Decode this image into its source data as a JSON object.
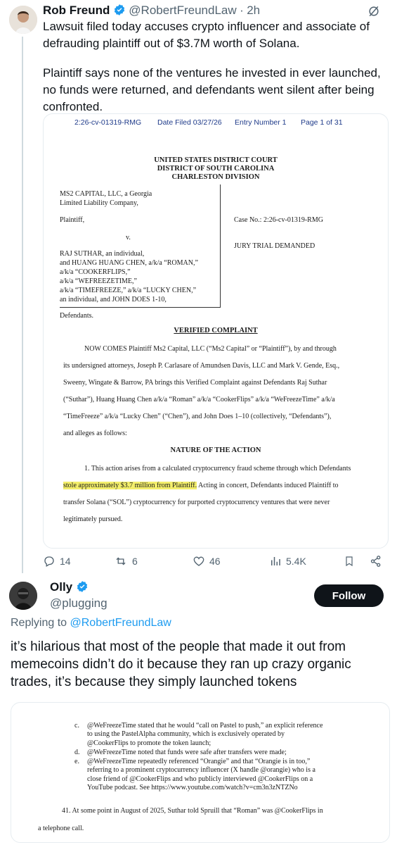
{
  "tweet1": {
    "author": {
      "name": "Rob Freund",
      "handle": "@RobertFreundLaw",
      "time": "2h",
      "verified": true
    },
    "text_p1": "Lawsuit filed today accuses crypto influencer and associate of defrauding plaintiff out of $3.7M worth of Solana.",
    "text_p2": "Plaintiff says none of the ventures he invested in ever launched, no funds were returned, and defendants went silent after being confronted.",
    "document": {
      "case_header": "2:26-cv-01319-RMG",
      "date_filed": "Date Filed 03/27/26",
      "entry_number": "Entry Number 1",
      "page": "Page 1 of 31",
      "court_lines": [
        "UNITED STATES DISTRICT COURT",
        "DISTRICT OF SOUTH CAROLINA",
        "CHARLESTON DIVISION"
      ],
      "plaintiff_lines": [
        "MS2 CAPITAL, LLC, a Georgia",
        "Limited Liability Company,"
      ],
      "plaintiff_label": "Plaintiff,",
      "versus": "v.",
      "case_no": "Case No.: 2:26-cv-01319-RMG",
      "jury": "JURY TRIAL DEMANDED",
      "defendant_lines": [
        "RAJ SUTHAR, an individual,",
        "and HUANG HUANG CHEN, a/k/a “ROMAN,”",
        "a/k/a “COOKERFLIPS,”",
        "a/k/a “WEFREEZETIME,”",
        "a/k/a “TIMEFREEZE,” a/k/a “LUCKY CHEN,”",
        "an individual, and JOHN DOES 1-10,"
      ],
      "defendants_label": "Defendants.",
      "complaint_title": "VERIFIED COMPLAINT",
      "intro_lines": [
        "NOW COMES Plaintiff Ms2 Capital, LLC (“Ms2 Capital” or “Plaintiff”), by and through",
        "its undersigned attorneys, Joseph P. Carlasare of Amundsen Davis, LLC and Mark V. Gende, Esq.,",
        "Sweeny, Wingate & Barrow, PA brings this Verified Complaint against Defendants Raj Suthar",
        "(“Suthar”), Huang Huang Chen a/k/a “Roman” a/k/a “CookerFlips” a/k/a “WeFreezeTime” a/k/a",
        "“TimeFreeze” a/k/a “Lucky Chen” (“Chen”), and John Does 1–10 (collectively, “Defendants”),",
        "and alleges as follows:"
      ],
      "nature_title": "NATURE OF THE ACTION",
      "nature_line1": "1. This action arises from a calculated cryptocurrency fraud scheme through which Defendants",
      "nature_highlight": "stole approximately $3.7 million from Plaintiff.",
      "nature_line2_rest": " Acting in concert, Defendants induced Plaintiff to",
      "nature_line3": "transfer Solana (“SOL”) cryptocurrency for purported cryptocurrency ventures that were never",
      "nature_line4": "legitimately pursued."
    },
    "actions": {
      "replies": "14",
      "reposts": "6",
      "likes": "46",
      "views": "5.4K"
    }
  },
  "tweet2": {
    "author": {
      "name": "Olly",
      "handle": "@plugging",
      "verified": true
    },
    "follow_label": "Follow",
    "replying_prefix": "Replying to ",
    "replying_to": "@RobertFreundLaw",
    "text": "it’s hilarious that most of the people that made it out from memecoins didn’t do it because they ran up crazy organic trades, it’s because they simply launched tokens",
    "document": {
      "items": [
        {
          "marker": "c.",
          "lines": [
            "@WeFreezeTime stated that he would “call on Pastel to push,” an explicit reference",
            "to using the PastelAlpha community, which is exclusively operated by",
            "@CookerFlips to promote the token launch;"
          ]
        },
        {
          "marker": "d.",
          "lines": [
            "@WeFreezeTime noted that funds were safe after transfers were made;"
          ]
        },
        {
          "marker": "e.",
          "lines": [
            "@WeFreezeTime repeatedly referenced “Orangie” and that “Orangie is in too,”",
            "referring to a prominent cryptocurrency influencer (X handle @orangie) who is a",
            "close friend of @CookerFlips and who publicly interviewed @CookerFlips on a",
            "YouTube podcast. See https://www.youtube.com/watch?v=cm3n3zNTZNo"
          ]
        }
      ],
      "para41_line1": "41. At some point in August of 2025, Suthar told Spruill that “Roman” was @CookerFlips in",
      "para41_line2": "a telephone call."
    }
  }
}
